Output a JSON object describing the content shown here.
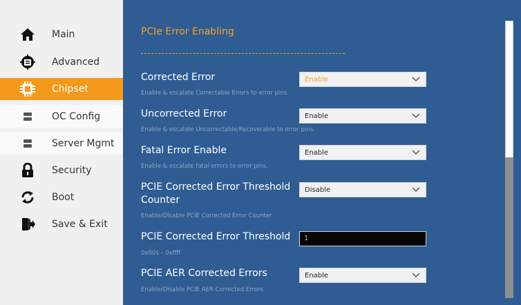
{
  "sidebar": {
    "items": [
      {
        "label": "Main",
        "icon": "home-icon"
      },
      {
        "label": "Advanced",
        "icon": "advanced-icon"
      },
      {
        "label": "Chipset",
        "icon": "chip-icon"
      },
      {
        "label": "OC Config",
        "icon": "server-icon"
      },
      {
        "label": "Server Mgmt",
        "icon": "server-icon"
      },
      {
        "label": "Security",
        "icon": "lock-icon"
      },
      {
        "label": "Boot",
        "icon": "refresh-icon"
      },
      {
        "label": "Save & Exit",
        "icon": "exit-icon"
      }
    ],
    "active_index": 2
  },
  "main": {
    "section_title": "PCIe Error Enabling",
    "options": [
      {
        "label": "Corrected Error",
        "value": "Enable",
        "help": "Enable & escalate Correctable Errors to error pins.",
        "type": "select",
        "highlighted": true
      },
      {
        "label": "Uncorrected Error",
        "value": "Enable",
        "help": "Enable & escalate Uncorrectable/Recoverable to error pins.",
        "type": "select"
      },
      {
        "label": "Fatal Error Enable",
        "value": "Enable",
        "help": "Enable & escalate fatal errors to error pins.",
        "type": "select"
      },
      {
        "label_line1": "PCIE Corrected Error Threshold",
        "label_line2": "Counter",
        "value": "Disable",
        "help": "Enable/Disable PCIE Corrected Error Counter",
        "type": "select"
      },
      {
        "label": "PCIE Corrected Error Threshold",
        "value": "1",
        "help": "0x001 - 0xffff",
        "type": "input"
      },
      {
        "label": "PCIE AER Corrected Errors",
        "value": "Enable",
        "help": "Enable/Disable PCIE AER Corrected Errors",
        "type": "select"
      }
    ]
  },
  "scrollbar": {
    "position_fraction": 0.49,
    "visible_fraction": 0.51
  },
  "colors": {
    "accent": "#f39a1c",
    "main_bg": "#2f5c93",
    "sidebar_bg": "#f0f0f0",
    "help_text": "#8fa6c4"
  }
}
